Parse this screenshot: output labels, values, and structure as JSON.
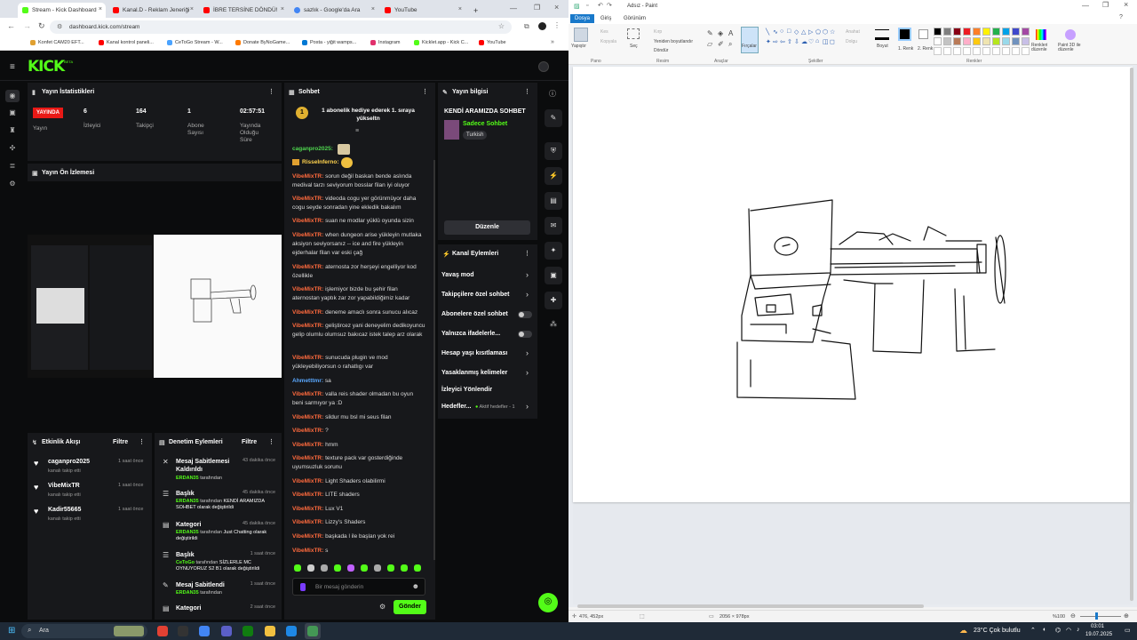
{
  "browser": {
    "tabs": [
      {
        "label": "Stream - Kick Dashboard",
        "color": "#53fc18"
      },
      {
        "label": "Kanal.D - Reklam Jeneriği",
        "color": "#ff0000"
      },
      {
        "label": "İBRE TERSİNE DÖNDÜ!",
        "color": "#ff0000"
      },
      {
        "label": "sazlık - Google'da Ara",
        "color": "#4285f4"
      },
      {
        "label": "YouTube",
        "color": "#ff0000"
      }
    ],
    "new_tab": "+",
    "url": "dashboard.kick.com/stream",
    "bookmarks": [
      {
        "label": "Konfet CAM20 EFT...",
        "color": "#e0a030"
      },
      {
        "label": "Kanal kontrol paneli...",
        "color": "#ff0000"
      },
      {
        "label": "CeToGo Stream - W...",
        "color": "#4aa3ff"
      },
      {
        "label": "Donate ByNoGame...",
        "color": "#ff7a00"
      },
      {
        "label": "Posta - yiğit wamps...",
        "color": "#0078d4"
      },
      {
        "label": "Instagram",
        "color": "#e1306c"
      },
      {
        "label": "Kicklet.app - Kick C...",
        "color": "#53fc18"
      },
      {
        "label": "YouTube",
        "color": "#ff0000"
      }
    ]
  },
  "kick": {
    "logo": "KICK",
    "beta": "BETA",
    "stats": {
      "title": "Yayın İstatistikleri",
      "live": "YAYINDA",
      "live_label": "Yayın",
      "viewers": "6",
      "viewers_label": "İzleyici",
      "followers": "164",
      "followers_label": "Takipçi",
      "subs": "1",
      "subs_label": "Abone Sayısı",
      "duration": "02:57:51",
      "duration_label": "Yayında Olduğu Süre"
    },
    "preview": {
      "title": "Yayın Ön İzlemesi"
    },
    "chat": {
      "title": "Sohbet",
      "pinned": "1 abonelik hediye ederek 1. sıraya yükseltn",
      "messages": [
        {
          "user": "caganpro2025:",
          "text": "",
          "cls": "g"
        },
        {
          "user": "RisseInferno:",
          "text": "",
          "cls": "y"
        },
        {
          "user": "VibeMixTR:",
          "text": "sorun değil baskan bende aslında medival tarzı seviyorum bosslar filan iyi oluyor",
          "cls": ""
        },
        {
          "user": "VibeMixTR:",
          "text": "videoda cogu yer görünmüyor daha cogu seyde sonradan yine ekledik bakalım",
          "cls": ""
        },
        {
          "user": "VibeMixTR:",
          "text": "suan ne modlar yüklü oyunda sizin",
          "cls": ""
        },
        {
          "user": "VibeMixTR:",
          "text": "when dungeon arise yükleyin mutlaka aksiyon seviyorsanız -- ice and fire yükleyin ejderhalar filan var eski çağ",
          "cls": ""
        },
        {
          "user": "VibeMixTR:",
          "text": "aternosta zor herşeyi engelliyor kod özellikle",
          "cls": ""
        },
        {
          "user": "VibeMixTR:",
          "text": "işlemiyor bizde bu şehir filan aternostan yaptık zar zor yapabildiğimiz kadar",
          "cls": ""
        },
        {
          "user": "VibeMixTR:",
          "text": "deneme amaclı sonra sunucu alıcaz",
          "cls": ""
        },
        {
          "user": "VibeMixTR:",
          "text": "geliştircez yani deneyelim dedikoyuncu gelip olumlu olumsuz bakıcaz istek talep arz olarak",
          "cls": ""
        },
        {
          "user": "VibeMixTR:",
          "text": "sunucuda plugin ve mod yükleyebiliyorsun o rahatlıgı var",
          "cls": ""
        },
        {
          "user": "Ahmetttmr:",
          "text": "sa",
          "cls": "b"
        },
        {
          "user": "VibeMixTR:",
          "text": "valla reis shader olmadan bu oyun beni sarmıyor ya :D",
          "cls": ""
        },
        {
          "user": "VibeMixTR:",
          "text": "sildur mu bsl mi seus filan",
          "cls": ""
        },
        {
          "user": "VibeMixTR:",
          "text": "?",
          "cls": ""
        },
        {
          "user": "VibeMixTR:",
          "text": "hmm",
          "cls": ""
        },
        {
          "user": "VibeMixTR:",
          "text": "texture pack var gosterdiğinde uyumsuzluk sorunu",
          "cls": ""
        },
        {
          "user": "VibeMixTR:",
          "text": "Light Shaders olabilirmi",
          "cls": ""
        },
        {
          "user": "VibeMixTR:",
          "text": "LITE shaders",
          "cls": ""
        },
        {
          "user": "VibeMixTR:",
          "text": "Lux V1",
          "cls": ""
        },
        {
          "user": "VibeMixTR:",
          "text": "Lizzy's Shaders",
          "cls": ""
        },
        {
          "user": "VibeMixTR:",
          "text": "başkada l ile başlan yok rei",
          "cls": ""
        },
        {
          "user": "VibeMixTR:",
          "text": "s",
          "cls": ""
        }
      ],
      "input_placeholder": "Bir mesaj gönderin",
      "send": "Gönder"
    },
    "info": {
      "title": "Yayın bilgisi",
      "stream_title": "KENDİ ARAMIZDA SOHBET",
      "category": "Sadece Sohbet",
      "tag": "Turkish",
      "edit": "Düzenle"
    },
    "actions": {
      "title": "Kanal Eylemleri",
      "items": [
        {
          "label": "Yavaş mod",
          "kind": "arrow"
        },
        {
          "label": "Takipçilere özel sohbet",
          "kind": "arrow"
        },
        {
          "label": "Abonelere özel sohbet",
          "kind": "toggle"
        },
        {
          "label": "Yalnızca ifadelerle...",
          "kind": "toggle"
        },
        {
          "label": "Hesap yaşı kısıtlaması",
          "kind": "arrow"
        },
        {
          "label": "Yasaklanmış kelimeler",
          "kind": "arrow"
        },
        {
          "label": "İzleyici Yönlendir",
          "kind": "none"
        },
        {
          "label": "Hedefler...",
          "kind": "arrow"
        }
      ],
      "goal_status": "Aktif hedefler - 1"
    },
    "activity": {
      "title": "Etkinlik Akışı",
      "filter": "Filtre",
      "items": [
        {
          "user": "caganpro2025",
          "sub": "kanalı takip etti",
          "time": "1 saat önce"
        },
        {
          "user": "VibeMixTR",
          "sub": "kanalı takip etti",
          "time": "1 saat önce"
        },
        {
          "user": "Kadir55665",
          "sub": "kanalı takip etti",
          "time": "1 saat önce"
        }
      ]
    },
    "moderation": {
      "title": "Denetim Eylemleri",
      "filter": "Filtre",
      "items": [
        {
          "action": "Mesaj Sabitlemesi Kaldırıldı",
          "who": "ERDAN35",
          "by": "tarafından",
          "detail": "",
          "time": "43 dakika önce"
        },
        {
          "action": "Başlık",
          "who": "ERDAN35",
          "by": "tarafından",
          "detail": "KENDİ ARAMIZDA SOHBET olarak değiştirildi",
          "time": "45 dakika önce"
        },
        {
          "action": "Kategori",
          "who": "ERDAN35",
          "by": "tarafından",
          "detail": "Just Chatting olarak değiştirildi",
          "time": "45 dakika önce"
        },
        {
          "action": "Başlık",
          "who": "CeToGo",
          "by": "tarafından",
          "detail": "SİZLERLE MC OYNUYORUZ S2 B1 olarak değiştirildi",
          "time": "1 saat önce"
        },
        {
          "action": "Mesaj Sabitlendi",
          "who": "ERDAN35",
          "by": "tarafından",
          "detail": "",
          "time": "1 saat önce"
        },
        {
          "action": "Kategori",
          "who": "",
          "by": "",
          "detail": "",
          "time": "2 saat önce"
        }
      ]
    }
  },
  "paint": {
    "title": "Adsız - Paint",
    "menu": [
      "Dosya",
      "Giriş",
      "Görünüm"
    ],
    "groups": [
      "Pano",
      "Resim",
      "Araçlar",
      "Şekiller",
      "Renkler"
    ],
    "labels": {
      "paste": "Yapıştır",
      "cut": "Kes",
      "copy": "Kopyala",
      "select": "Seç",
      "crop": "Kırp",
      "resize": "Yeniden boyutlandır",
      "rotate": "Döndür",
      "brushes": "Fırçalar",
      "outline": "Anahat",
      "fill": "Dolgu",
      "size": "Boyut",
      "color1": "1. Renk",
      "color2": "2. Renk",
      "edit_colors": "Renkleri düzenle",
      "paint3d": "Paint 3D ile düzenle"
    },
    "palette": [
      "#000000",
      "#7f7f7f",
      "#880015",
      "#ed1c24",
      "#ff7f27",
      "#fff200",
      "#22b14c",
      "#00a2e8",
      "#3f48cc",
      "#a349a4",
      "#ffffff",
      "#c3c3c3",
      "#b97a57",
      "#ffaec9",
      "#ffc90e",
      "#efe4b0",
      "#b5e61d",
      "#99d9ea",
      "#7092be",
      "#c8bfe7"
    ],
    "status": {
      "pos": "476, 452px",
      "canvas_size": "2056 × 978px",
      "zoom": "%100"
    }
  },
  "taskbar": {
    "search": "Ara",
    "weather": "23°C  Çok bulutlu",
    "time": "03:01",
    "date": "19.07.2025"
  }
}
